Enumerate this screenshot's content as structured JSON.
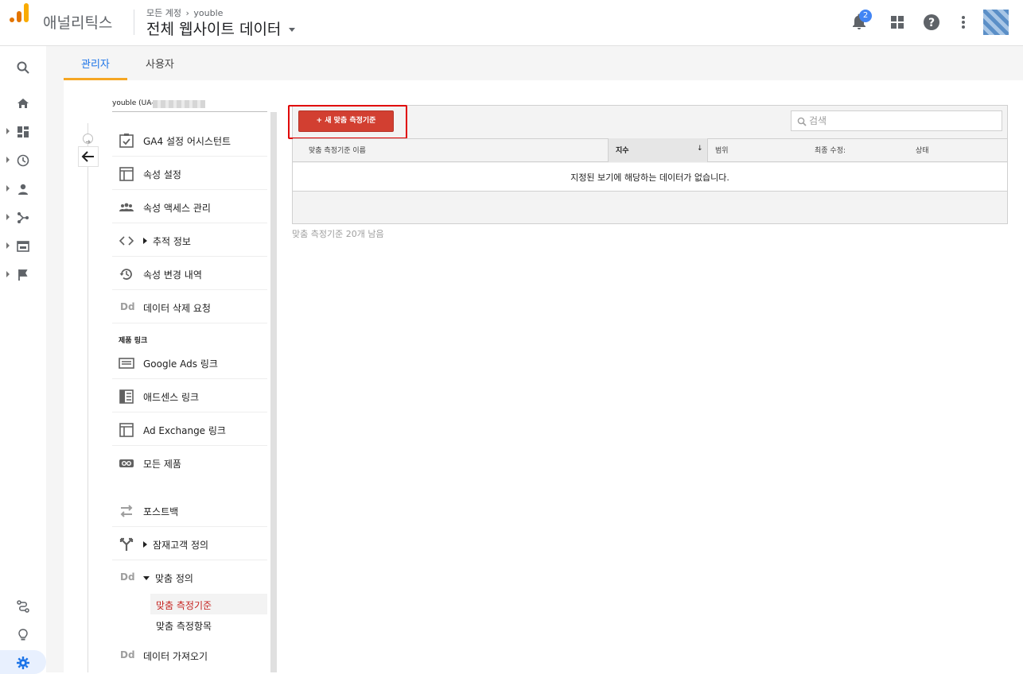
{
  "header": {
    "brand": "애널리틱스",
    "breadcrumb_root": "모든 계정",
    "breadcrumb_account": "youble",
    "view_title": "전체 웹사이트 데이터",
    "notification_count": "2"
  },
  "tabs": [
    {
      "label": "관리자",
      "active": true
    },
    {
      "label": "사용자",
      "active": false
    }
  ],
  "property": {
    "title": "youble (UA-"
  },
  "menu": {
    "items": [
      {
        "label": "GA4 설정 어시스턴트",
        "icon": "checklist-icon"
      },
      {
        "label": "속성 설정",
        "icon": "layout-icon"
      },
      {
        "label": "속성 액세스 관리",
        "icon": "people-icon"
      },
      {
        "label": "추적 정보",
        "icon": "code-icon",
        "expandable": true
      },
      {
        "label": "속성 변경 내역",
        "icon": "history-icon"
      },
      {
        "label": "데이터 삭제 요청",
        "icon": "dd-icon"
      }
    ],
    "section_label": "제품 링크",
    "links": [
      {
        "label": "Google Ads 링크",
        "icon": "ads-icon"
      },
      {
        "label": "애드센스 링크",
        "icon": "adsense-icon"
      },
      {
        "label": "Ad Exchange 링크",
        "icon": "adexchange-icon"
      },
      {
        "label": "모든 제품",
        "icon": "link-icon"
      }
    ],
    "other": [
      {
        "label": "포스트백",
        "icon": "swap-icon"
      },
      {
        "label": "잠재고객 정의",
        "icon": "fork-icon",
        "expandable": true
      },
      {
        "label": "맞춤 정의",
        "icon": "dd-icon",
        "expanded": true
      }
    ],
    "sub_items": [
      {
        "label": "맞춤 측정기준",
        "selected": true
      },
      {
        "label": "맞춤 측정항목",
        "selected": false
      }
    ],
    "last": {
      "label": "데이터 가져오기",
      "icon": "dd-icon"
    },
    "dd_glyph": "Dd"
  },
  "main": {
    "new_button_label": "+ 새 맞춤 측정기준",
    "search_placeholder": "검색",
    "columns": [
      "맞춤 측정기준 이름",
      "지수",
      "범위",
      "최종 수정:",
      "상태"
    ],
    "sorted_column": "지수",
    "sort_arrow": "↓",
    "empty_message": "지정된 보기에 해당하는 데이터가 없습니다.",
    "remaining_text": "맞춤 측정기준 20개 남음"
  },
  "colors": {
    "accent": "#f5a623",
    "button": "#d23f31",
    "highlight": "#e00000",
    "selected_text": "#c5221f"
  }
}
